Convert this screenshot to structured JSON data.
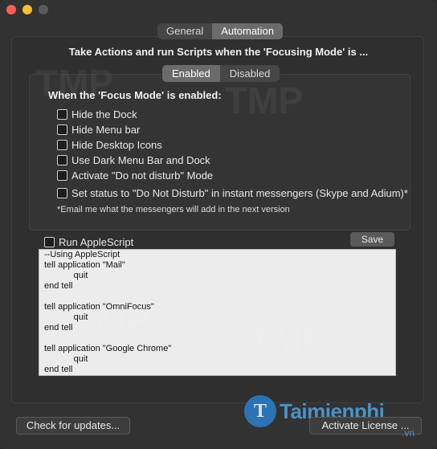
{
  "tabs": [
    {
      "label": "General",
      "active": false
    },
    {
      "label": "Automation",
      "active": true
    }
  ],
  "headline": "Take Actions and run Scripts when the 'Focusing Mode' is ...",
  "mode_toggle": [
    {
      "label": "Enabled",
      "active": true
    },
    {
      "label": "Disabled",
      "active": false
    }
  ],
  "section_title": "When the 'Focus Mode' is enabled:",
  "options": [
    {
      "label": "Hide the Dock",
      "checked": false
    },
    {
      "label": "Hide Menu bar",
      "checked": false
    },
    {
      "label": "Hide Desktop Icons",
      "checked": false
    },
    {
      "label": "Use Dark Menu Bar and Dock",
      "checked": false
    },
    {
      "label": "Activate \"Do not disturb\" Mode",
      "checked": false
    },
    {
      "label": "Set status to \"Do Not Disturb\" in instant messengers (Skype and Adium)*",
      "checked": false
    }
  ],
  "note": "*Email me what the messengers will add in the next version",
  "run_script": {
    "label": "Run AppleScript",
    "checked": false
  },
  "save_label": "Save",
  "script_text": "--Using AppleScript\ntell application \"Mail\"\n            quit\nend tell\n\ntell application \"OmniFocus\"\n            quit\nend tell\n\ntell application \"Google Chrome\"\n            quit\nend tell",
  "footer": {
    "check_updates": "Check for updates...",
    "activate_license": "Activate License ..."
  },
  "watermark": {
    "brand": "Taimienphi",
    "tld": ".vn",
    "logo_letter": "T",
    "overlay_text": "TMP"
  },
  "colors": {
    "window_bg": "#323232",
    "segment_active": "#6b6b6b",
    "script_bg": "#ececec",
    "brand_blue": "#2a7fc9"
  }
}
